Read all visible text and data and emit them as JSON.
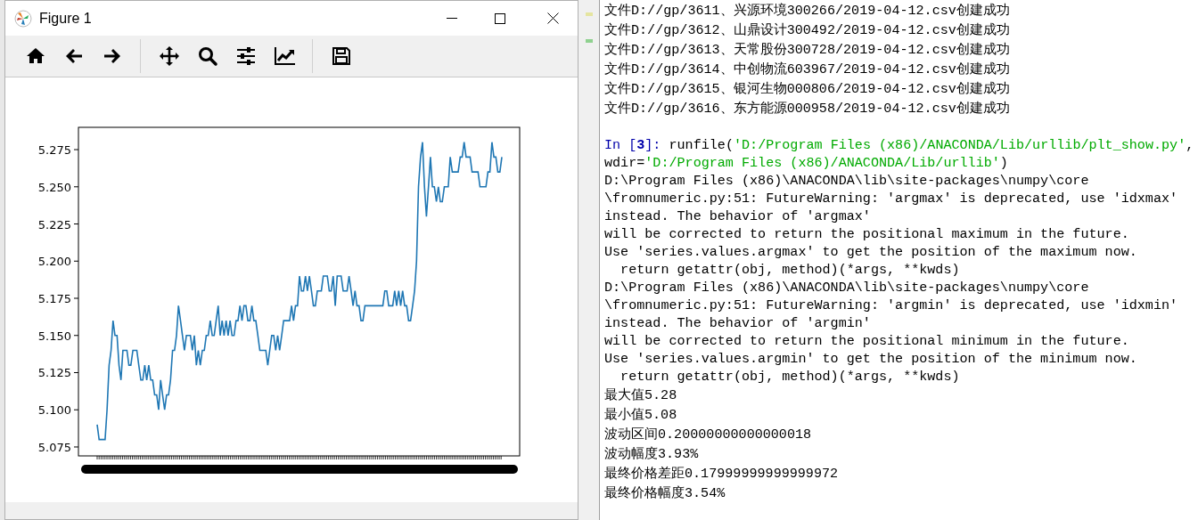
{
  "figure_window": {
    "title": "Figure 1",
    "toolbar": [
      {
        "kind": "home"
      },
      {
        "kind": "back"
      },
      {
        "kind": "forward"
      },
      {
        "kind": "separator"
      },
      {
        "kind": "pan"
      },
      {
        "kind": "zoom"
      },
      {
        "kind": "subplots"
      },
      {
        "kind": "lines"
      },
      {
        "kind": "separator"
      },
      {
        "kind": "save"
      }
    ],
    "chart_data": {
      "type": "line",
      "ylim": [
        5.069,
        5.29
      ],
      "yticks": [
        {
          "value": 5.075,
          "label": "5.075"
        },
        {
          "value": 5.1,
          "label": "5.100"
        },
        {
          "value": 5.125,
          "label": "5.125"
        },
        {
          "value": 5.15,
          "label": "5.150"
        },
        {
          "value": 5.175,
          "label": "5.175"
        },
        {
          "value": 5.2,
          "label": "5.200"
        },
        {
          "value": 5.225,
          "label": "5.225"
        },
        {
          "value": 5.25,
          "label": "5.250"
        },
        {
          "value": 5.275,
          "label": "5.275"
        }
      ],
      "series": [
        {
          "color": "#1f77b4",
          "values": [
            5.09,
            5.08,
            5.08,
            5.08,
            5.08,
            5.1,
            5.13,
            5.14,
            5.16,
            5.15,
            5.15,
            5.13,
            5.12,
            5.14,
            5.14,
            5.14,
            5.13,
            5.13,
            5.14,
            5.14,
            5.14,
            5.13,
            5.12,
            5.12,
            5.13,
            5.12,
            5.13,
            5.12,
            5.12,
            5.11,
            5.11,
            5.1,
            5.12,
            5.11,
            5.1,
            5.11,
            5.11,
            5.12,
            5.14,
            5.14,
            5.15,
            5.17,
            5.16,
            5.15,
            5.14,
            5.15,
            5.15,
            5.15,
            5.14,
            5.15,
            5.13,
            5.14,
            5.13,
            5.14,
            5.14,
            5.15,
            5.15,
            5.16,
            5.15,
            5.15,
            5.16,
            5.17,
            5.15,
            5.16,
            5.15,
            5.16,
            5.15,
            5.16,
            5.15,
            5.15,
            5.16,
            5.16,
            5.17,
            5.16,
            5.17,
            5.17,
            5.16,
            5.16,
            5.17,
            5.16,
            5.16,
            5.15,
            5.14,
            5.14,
            5.14,
            5.14,
            5.13,
            5.14,
            5.15,
            5.15,
            5.14,
            5.15,
            5.14,
            5.15,
            5.16,
            5.16,
            5.16,
            5.16,
            5.17,
            5.16,
            5.17,
            5.17,
            5.19,
            5.18,
            5.18,
            5.19,
            5.18,
            5.19,
            5.18,
            5.17,
            5.17,
            5.18,
            5.18,
            5.18,
            5.19,
            5.19,
            5.19,
            5.18,
            5.18,
            5.19,
            5.17,
            5.19,
            5.19,
            5.19,
            5.18,
            5.18,
            5.18,
            5.19,
            5.18,
            5.17,
            5.18,
            5.17,
            5.17,
            5.16,
            5.16,
            5.17,
            5.17,
            5.17,
            5.17,
            5.17,
            5.17,
            5.17,
            5.17,
            5.17,
            5.17,
            5.18,
            5.18,
            5.17,
            5.17,
            5.17,
            5.18,
            5.17,
            5.18,
            5.17,
            5.18,
            5.17,
            5.17,
            5.16,
            5.16,
            5.17,
            5.18,
            5.2,
            5.25,
            5.27,
            5.28,
            5.25,
            5.23,
            5.25,
            5.27,
            5.25,
            5.25,
            5.24,
            5.25,
            5.24,
            5.24,
            5.25,
            5.25,
            5.25,
            5.27,
            5.26,
            5.26,
            5.26,
            5.26,
            5.27,
            5.27,
            5.28,
            5.27,
            5.27,
            5.27,
            5.26,
            5.26,
            5.26,
            5.26,
            5.25,
            5.25,
            5.25,
            5.25,
            5.26,
            5.26,
            5.28,
            5.27,
            5.27,
            5.26,
            5.26,
            5.27
          ]
        }
      ]
    }
  },
  "console": {
    "created_lines": [
      "文件D://gp/3611、兴源环境300266/2019-04-12.csv创建成功",
      "文件D://gp/3612、山鼎设计300492/2019-04-12.csv创建成功",
      "文件D://gp/3613、天常股份300728/2019-04-12.csv创建成功",
      "文件D://gp/3614、中创物流603967/2019-04-12.csv创建成功",
      "文件D://gp/3615、银河生物000806/2019-04-12.csv创建成功",
      "文件D://gp/3616、东方能源000958/2019-04-12.csv创建成功"
    ],
    "input_lines": [
      [
        {
          "kind": "prompt",
          "text": "In ["
        },
        {
          "kind": "number",
          "text": "3"
        },
        {
          "kind": "prompt",
          "text": "]: "
        },
        {
          "kind": "code",
          "text": "runfile("
        },
        {
          "kind": "string",
          "text": "'D:/Program Files (x86)/ANACONDA/Lib/urllib/plt_show.py'"
        },
        {
          "kind": "code",
          "text": ","
        }
      ],
      [
        {
          "kind": "code",
          "text": "wdir="
        },
        {
          "kind": "string",
          "text": "'D:/Program Files (x86)/ANACONDA/Lib/urllib'"
        },
        {
          "kind": "code",
          "text": ")"
        }
      ]
    ],
    "log_lines": [
      "D:\\Program Files (x86)\\ANACONDA\\lib\\site-packages\\numpy\\core",
      "\\fromnumeric.py:51: FutureWarning: 'argmax' is deprecated, use 'idxmax'",
      "instead. The behavior of 'argmax'",
      "will be corrected to return the positional maximum in the future.",
      "Use 'series.values.argmax' to get the position of the maximum now.",
      "  return getattr(obj, method)(*args, **kwds)",
      "D:\\Program Files (x86)\\ANACONDA\\lib\\site-packages\\numpy\\core",
      "\\fromnumeric.py:51: FutureWarning: 'argmin' is deprecated, use 'idxmin'",
      "instead. The behavior of 'argmin'",
      "will be corrected to return the positional minimum in the future.",
      "Use 'series.values.argmin' to get the position of the minimum now.",
      "  return getattr(obj, method)(*args, **kwds)"
    ],
    "result_lines": [
      "最大值5.28",
      "最小值5.08",
      "波动区间0.20000000000000018",
      "波动幅度3.93%",
      "最终价格差距0.17999999999999972",
      "最终价格幅度3.54%"
    ]
  }
}
